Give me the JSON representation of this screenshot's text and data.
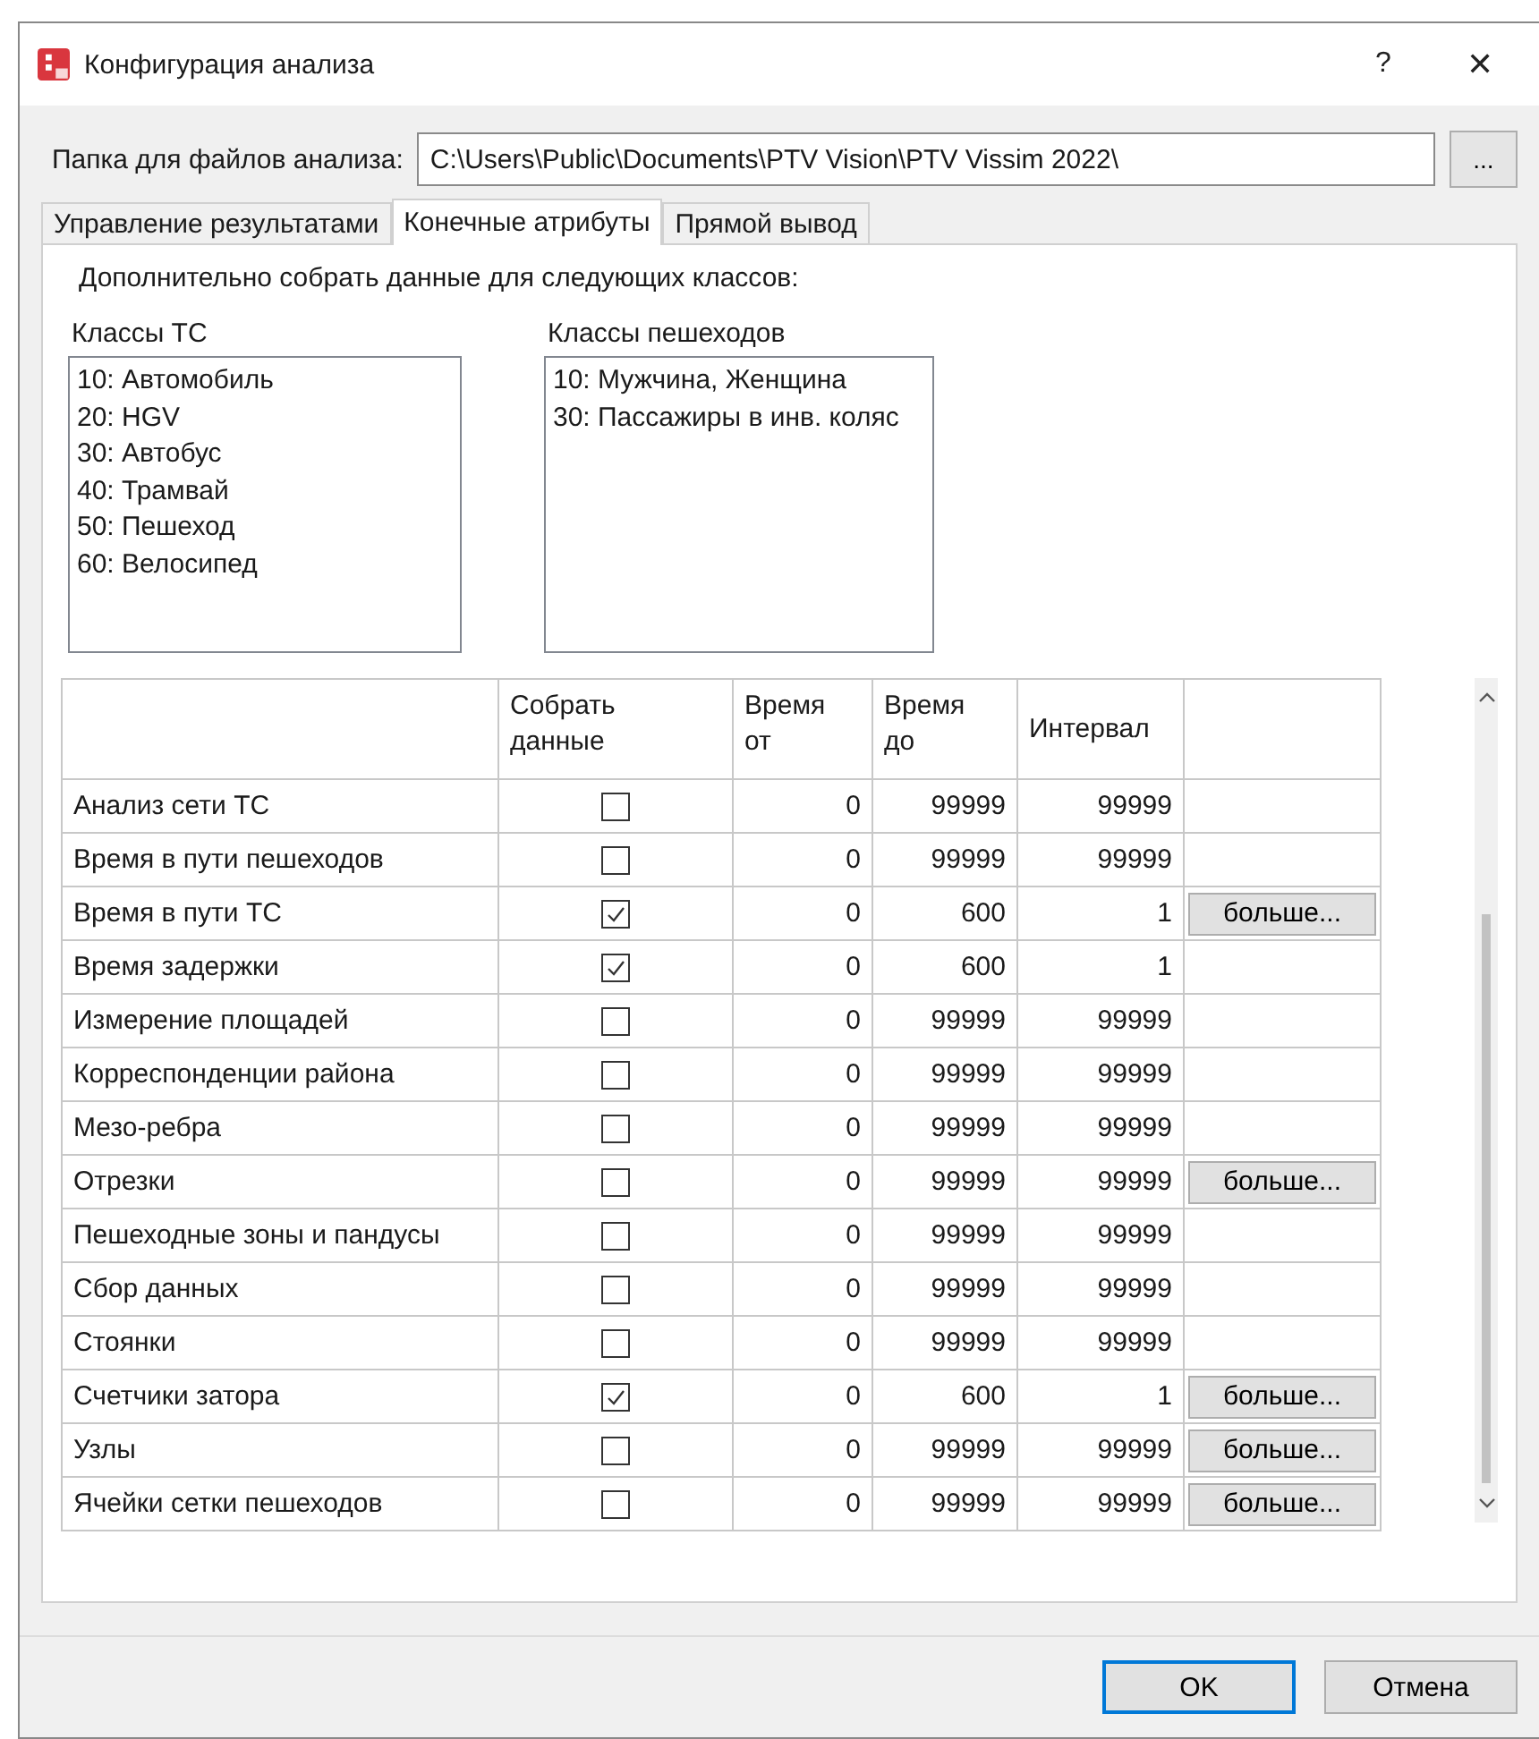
{
  "window": {
    "title": "Конфигурация анализа",
    "help": "?",
    "close": "✕"
  },
  "folder": {
    "label": "Папка для файлов анализа:",
    "value": "C:\\Users\\Public\\Documents\\PTV Vision\\PTV Vissim 2022\\",
    "browse": "..."
  },
  "tabs": [
    {
      "label": "Управление результатами",
      "selected": false
    },
    {
      "label": "Конечные атрибуты",
      "selected": true
    },
    {
      "label": "Прямой вывод",
      "selected": false
    }
  ],
  "intro": "Дополнительно собрать данные для следующих классов:",
  "vehicle_classes": {
    "title": "Классы ТС",
    "items": [
      "10: Автомобиль",
      "20: HGV",
      "30: Автобус",
      "40: Трамвай",
      "50: Пешеход",
      "60: Велосипед"
    ]
  },
  "pedestrian_classes": {
    "title": "Классы пешеходов",
    "items": [
      "10: Мужчина, Женщина",
      "30: Пассажиры в инв. коляс"
    ]
  },
  "table": {
    "columns": [
      "Собрать данные",
      "Время от",
      "Время до",
      "Интервал"
    ],
    "rows": [
      {
        "name": "Анализ сети ТС",
        "checked": false,
        "from": "0",
        "to": "99999",
        "interval": "99999"
      },
      {
        "name": "Время в пути пешеходов",
        "checked": false,
        "from": "0",
        "to": "99999",
        "interval": "99999"
      },
      {
        "name": "Время в пути ТС",
        "checked": true,
        "from": "0",
        "to": "600",
        "interval": "1",
        "more": "больше..."
      },
      {
        "name": "Время задержки",
        "checked": true,
        "from": "0",
        "to": "600",
        "interval": "1"
      },
      {
        "name": "Измерение площадей",
        "checked": false,
        "from": "0",
        "to": "99999",
        "interval": "99999"
      },
      {
        "name": "Корреспонденции района",
        "checked": false,
        "from": "0",
        "to": "99999",
        "interval": "99999"
      },
      {
        "name": "Мезо-ребра",
        "checked": false,
        "from": "0",
        "to": "99999",
        "interval": "99999"
      },
      {
        "name": "Отрезки",
        "checked": false,
        "from": "0",
        "to": "99999",
        "interval": "99999",
        "more": "больше..."
      },
      {
        "name": "Пешеходные зоны и пандусы",
        "checked": false,
        "from": "0",
        "to": "99999",
        "interval": "99999"
      },
      {
        "name": "Сбор данных",
        "checked": false,
        "from": "0",
        "to": "99999",
        "interval": "99999"
      },
      {
        "name": "Стоянки",
        "checked": false,
        "from": "0",
        "to": "99999",
        "interval": "99999"
      },
      {
        "name": "Счетчики затора",
        "checked": true,
        "from": "0",
        "to": "600",
        "interval": "1",
        "more": "больше..."
      },
      {
        "name": "Узлы",
        "checked": false,
        "from": "0",
        "to": "99999",
        "interval": "99999",
        "more": "больше..."
      },
      {
        "name": "Ячейки сетки пешеходов",
        "checked": false,
        "from": "0",
        "to": "99999",
        "interval": "99999",
        "more": "больше..."
      }
    ]
  },
  "buttons": [
    {
      "label": "OK",
      "kind": "default"
    },
    {
      "label": "Отмена",
      "kind": "normal"
    }
  ]
}
